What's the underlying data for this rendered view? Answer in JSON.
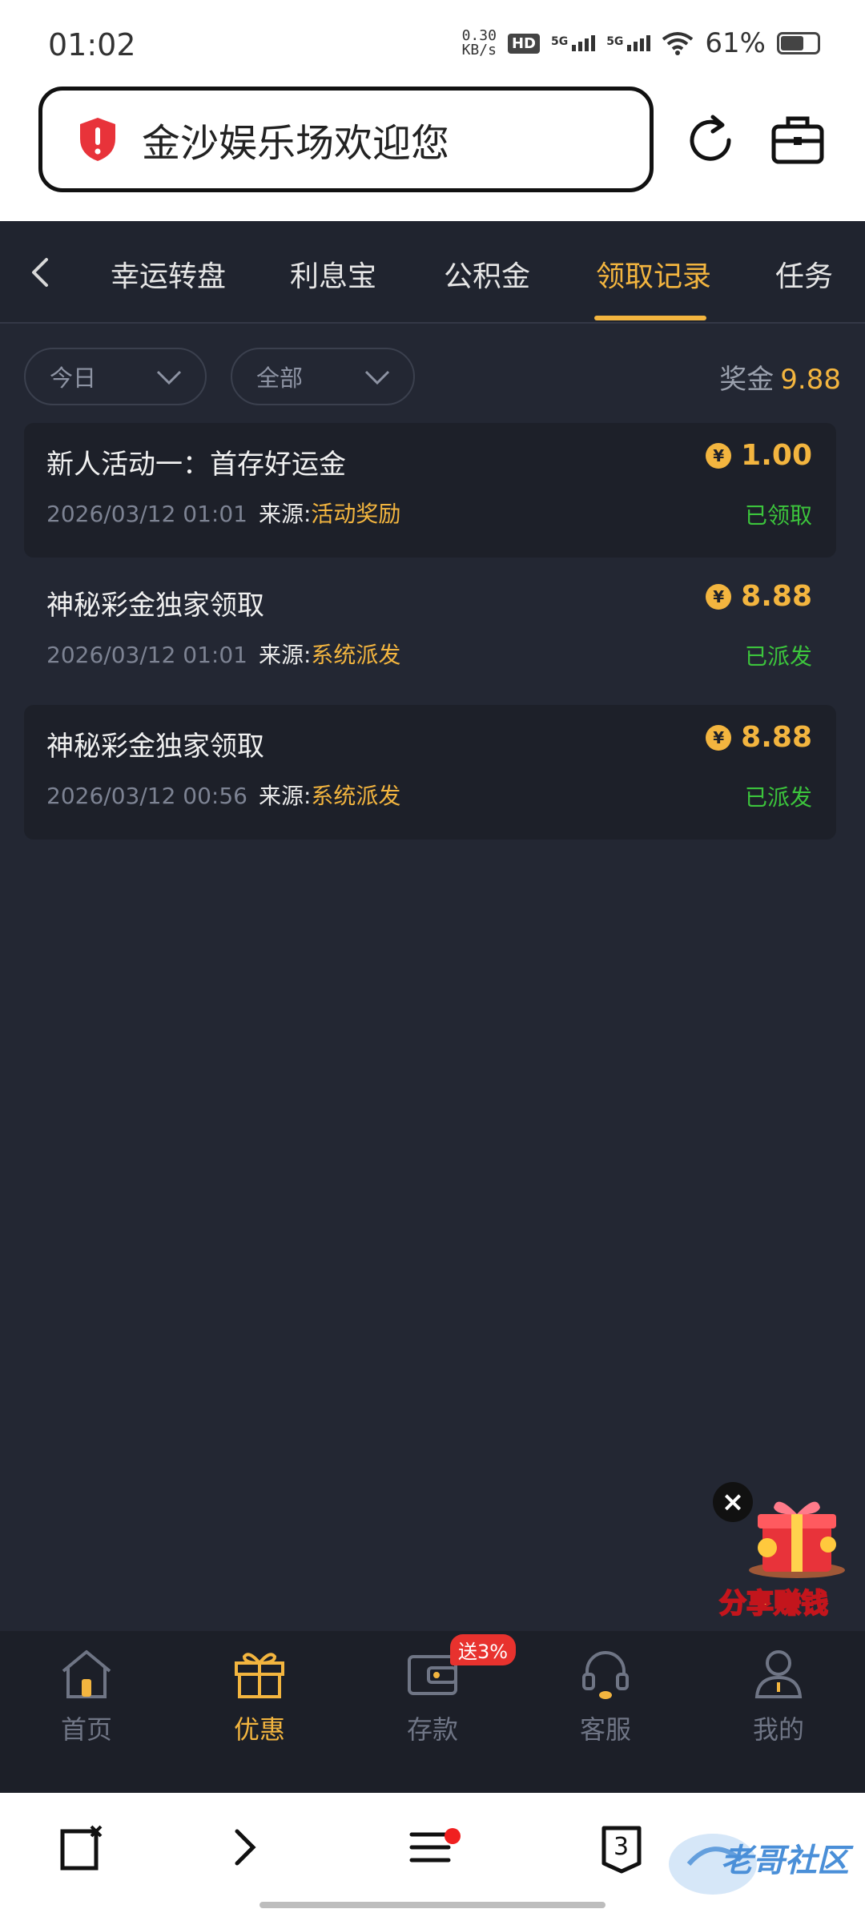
{
  "status_bar": {
    "time": "01:02",
    "net_speed_value": "0.30",
    "net_speed_unit": "KB/s",
    "hd_label": "HD",
    "signal1_label": "5G",
    "signal2_label": "5G",
    "battery": "61%"
  },
  "browser": {
    "url_text": "金沙娱乐场欢迎您"
  },
  "tabs": [
    {
      "label": "幸运转盘"
    },
    {
      "label": "利息宝"
    },
    {
      "label": "公积金"
    },
    {
      "label": "领取记录"
    },
    {
      "label": "任务"
    }
  ],
  "filters": {
    "date": "今日",
    "type": "全部",
    "bonus_label": "奖金",
    "bonus_value": "9.88"
  },
  "records": [
    {
      "title": "新人活动一：首存好运金",
      "time": "2026/03/12 01:01",
      "source_label": "来源:",
      "source": "活动奖励",
      "amount": "1.00",
      "status": "已领取"
    },
    {
      "title": "神秘彩金独家领取",
      "time": "2026/03/12 01:01",
      "source_label": "来源:",
      "source": "系统派发",
      "amount": "8.88",
      "status": "已派发"
    },
    {
      "title": "神秘彩金独家领取",
      "time": "2026/03/12 00:56",
      "source_label": "来源:",
      "source": "系统派发",
      "amount": "8.88",
      "status": "已派发"
    }
  ],
  "coin_symbol": "¥",
  "promo": {
    "text": "分享赚钱",
    "close": "×"
  },
  "bottom_nav": [
    {
      "label": "首页"
    },
    {
      "label": "优惠"
    },
    {
      "label": "存款",
      "badge": "送3%"
    },
    {
      "label": "客服"
    },
    {
      "label": "我的"
    }
  ],
  "browser_bottom": {
    "tab_count": "3",
    "watermark": "老哥社区"
  },
  "colors": {
    "accent": "#f3b53f",
    "success": "#3cc43c",
    "background": "#232733"
  }
}
